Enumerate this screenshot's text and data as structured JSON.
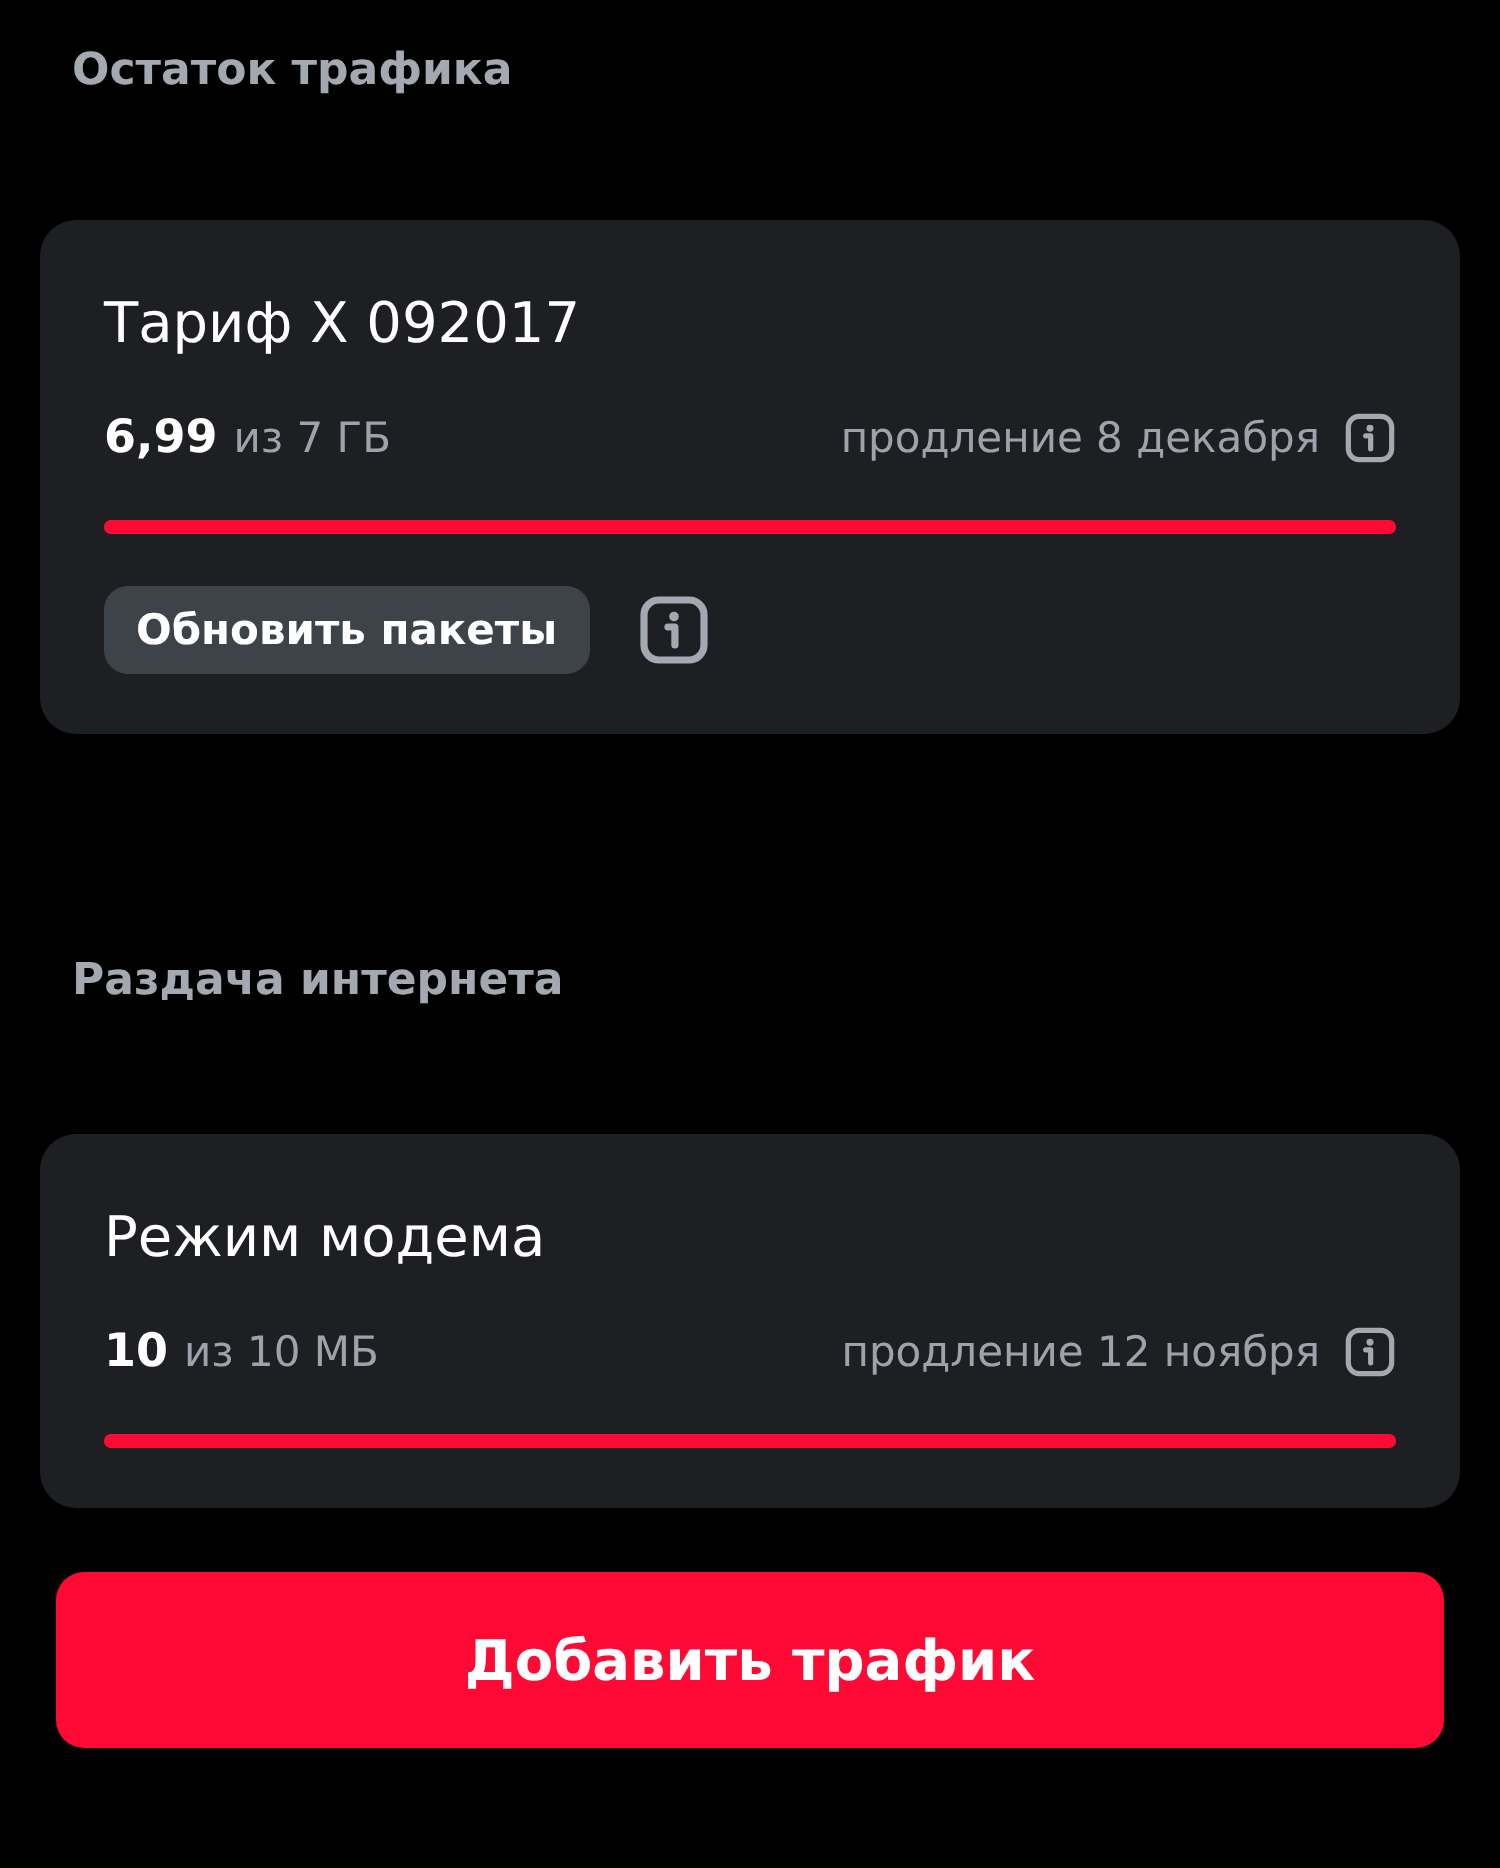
{
  "sections": [
    {
      "title": "Остаток трафика",
      "card": {
        "name": "Тариф X 092017",
        "used": "6,99",
        "total": "из 7 ГБ",
        "renewal": "продление 8 декабря",
        "level": 1,
        "action": "Обновить пакеты"
      }
    },
    {
      "title": "Раздача интернета",
      "card": {
        "name": "Режим модема",
        "used": "10",
        "total": "из 10 МБ",
        "renewal": "продление 12 ноября",
        "level": 1
      }
    }
  ],
  "add_button": "Добавить трафик"
}
